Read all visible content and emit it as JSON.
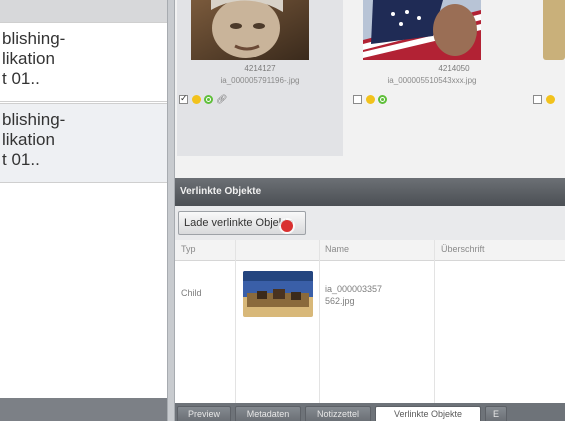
{
  "left_list": {
    "items": [
      {
        "text": "blishing-\nlikation\nt 01.."
      },
      {
        "text": "blishing-\nlikation\nt 01.."
      }
    ]
  },
  "thumbnails": [
    {
      "id": "4214127",
      "filename": "ia_000005791196-.jpg",
      "checked": true,
      "selected": true
    },
    {
      "id": "4214050",
      "filename": "ia_000005510543xxx.jpg",
      "checked": false,
      "selected": false
    },
    {
      "id": "",
      "filename": "",
      "checked": false,
      "selected": false
    }
  ],
  "section": {
    "title": "Verlinkte Objekte"
  },
  "toolbar": {
    "load_label": "Lade verlinkte Objekte"
  },
  "table": {
    "headers": [
      "Typ",
      "",
      "Name",
      "Überschrift"
    ],
    "rows": [
      {
        "typ": "Child",
        "name_line1": "ia_000003357",
        "name_line2": "562.jpg",
        "ueberschrift": ""
      }
    ]
  },
  "tabs": [
    {
      "label": "Preview",
      "active": false
    },
    {
      "label": "Metadaten",
      "active": false
    },
    {
      "label": "Notizzettel",
      "active": false
    },
    {
      "label": "Verlinkte Objekte",
      "active": true
    },
    {
      "label": "E",
      "active": false
    }
  ],
  "icons": {
    "checkbox": "checkbox-icon",
    "status_yellow": "status-yellow-dot-icon",
    "status_green": "status-green-dot-icon",
    "link": "link-icon",
    "cursor": "mouse-cursor-icon"
  },
  "colors": {
    "accent_header": "#4b4f54",
    "status_yellow": "#f2c21c",
    "status_green": "#5fbf3a"
  }
}
